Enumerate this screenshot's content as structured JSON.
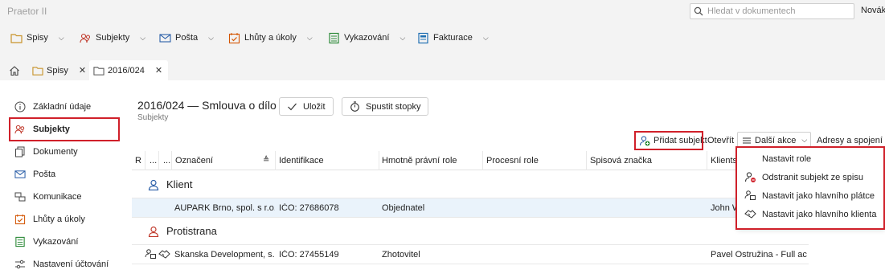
{
  "app": {
    "title": "Praetor II"
  },
  "search": {
    "placeholder": "Hledat v dokumentech"
  },
  "user": {
    "label": "Novák"
  },
  "menu": [
    {
      "label": "Spisy",
      "icon": "folder-icon"
    },
    {
      "label": "Subjekty",
      "icon": "people-icon"
    },
    {
      "label": "Pošta",
      "icon": "mail-icon"
    },
    {
      "label": "Lhůty a úkoly",
      "icon": "calendar-check-icon"
    },
    {
      "label": "Vykazování",
      "icon": "ledger-icon"
    },
    {
      "label": "Fakturace",
      "icon": "invoice-icon"
    }
  ],
  "tabs": {
    "home_icon": "home-icon",
    "tab1": "Spisy",
    "tab2": "2016/024"
  },
  "sidebar": {
    "items": [
      {
        "label": "Základní údaje",
        "icon": "info-icon"
      },
      {
        "label": "Subjekty",
        "icon": "people-icon"
      },
      {
        "label": "Dokumenty",
        "icon": "documents-icon"
      },
      {
        "label": "Pošta",
        "icon": "mail-icon"
      },
      {
        "label": "Komunikace",
        "icon": "communication-icon"
      },
      {
        "label": "Lhůty a úkoly",
        "icon": "calendar-check-icon"
      },
      {
        "label": "Vykazování",
        "icon": "ledger-icon"
      },
      {
        "label": "Nastavení účtování",
        "icon": "sliders-icon"
      }
    ]
  },
  "document": {
    "title": "2016/024 — Smlouva o dílo",
    "subtitle": "Subjekty"
  },
  "actions": {
    "save": "Uložit",
    "stopwatch": "Spustit stopky"
  },
  "toolbar": {
    "add_subject": "Přidat subjekt",
    "open": "Otevřít",
    "more": "Další akce",
    "addresses": "Adresy a spojení"
  },
  "table": {
    "headers": {
      "r": "R",
      "dots1": "...",
      "dots2": "...",
      "designation": "Označení",
      "identification": "Identifikace",
      "material_role": "Hmotně právní role",
      "procedural_role": "Procesní role",
      "file_number": "Spisová značka",
      "clients": "Klients"
    },
    "groups": [
      {
        "label": "Klient"
      },
      {
        "label": "Protistrana"
      }
    ],
    "rows": [
      {
        "designation": "AUPARK Brno, spol. s r.o.",
        "identification": "IČO: 27686078",
        "material_role": "Objednatel",
        "procedural_role": "",
        "file_number": "",
        "clients": "John W"
      },
      {
        "designation": "Skanska Development, s.r.o",
        "identification": "IČO: 27455149",
        "material_role": "Zhotovitel",
        "procedural_role": "",
        "file_number": "",
        "clients": "Pavel Ostružina - Full acce"
      }
    ]
  },
  "dropdown": {
    "items": [
      {
        "label": "Nastavit role",
        "icon": ""
      },
      {
        "label": "Odstranit subjekt ze spisu",
        "icon": "remove-person-icon"
      },
      {
        "label": "Nastavit jako hlavního plátce",
        "icon": "payer-icon"
      },
      {
        "label": "Nastavit jako hlavního klienta",
        "icon": "handshake-icon"
      }
    ]
  },
  "colors": {
    "accent_red": "#d0202a",
    "icon_blue": "#2b5fa8",
    "selected_row": "#eaf3fb"
  }
}
